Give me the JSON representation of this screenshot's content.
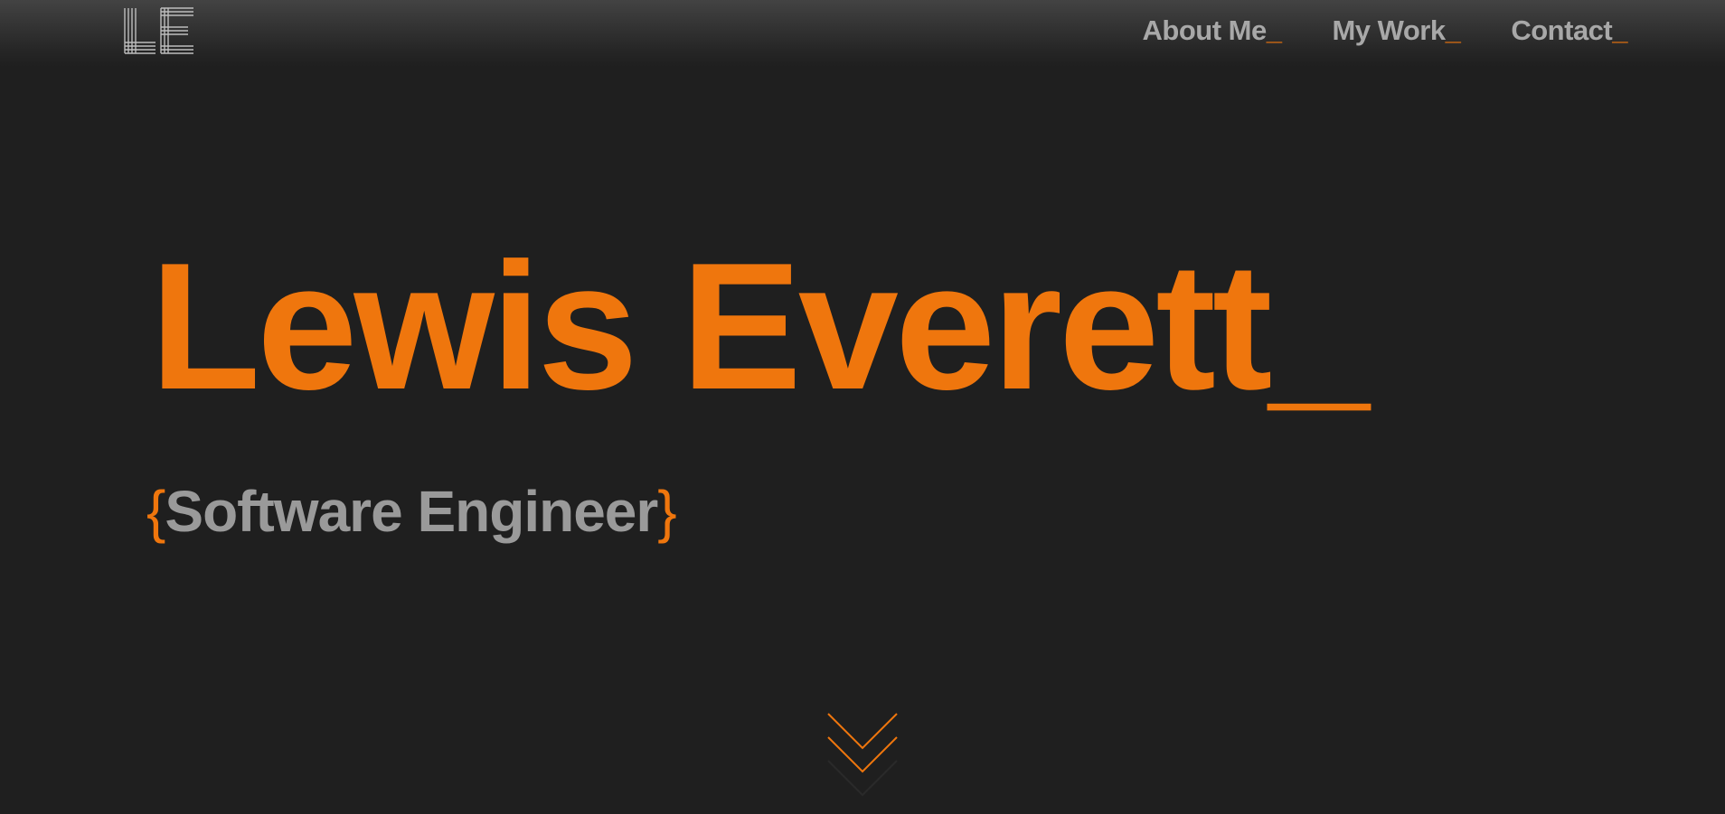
{
  "header": {
    "logo_text": "LE",
    "nav": [
      {
        "label": "About Me",
        "suffix": "_"
      },
      {
        "label": "My Work",
        "suffix": "_"
      },
      {
        "label": "Contact",
        "suffix": "_"
      }
    ]
  },
  "hero": {
    "name": "Lewis Everett",
    "name_suffix": "_",
    "role_open": "{",
    "role": "Software Engineer",
    "role_close": "}"
  },
  "scroll": {
    "icon": "chevron-double-down-icon"
  },
  "colors": {
    "background": "#1f1f1f",
    "accent": "#ef760d",
    "text_muted": "#9a9a9a",
    "nav_text": "#a8a8a8"
  }
}
